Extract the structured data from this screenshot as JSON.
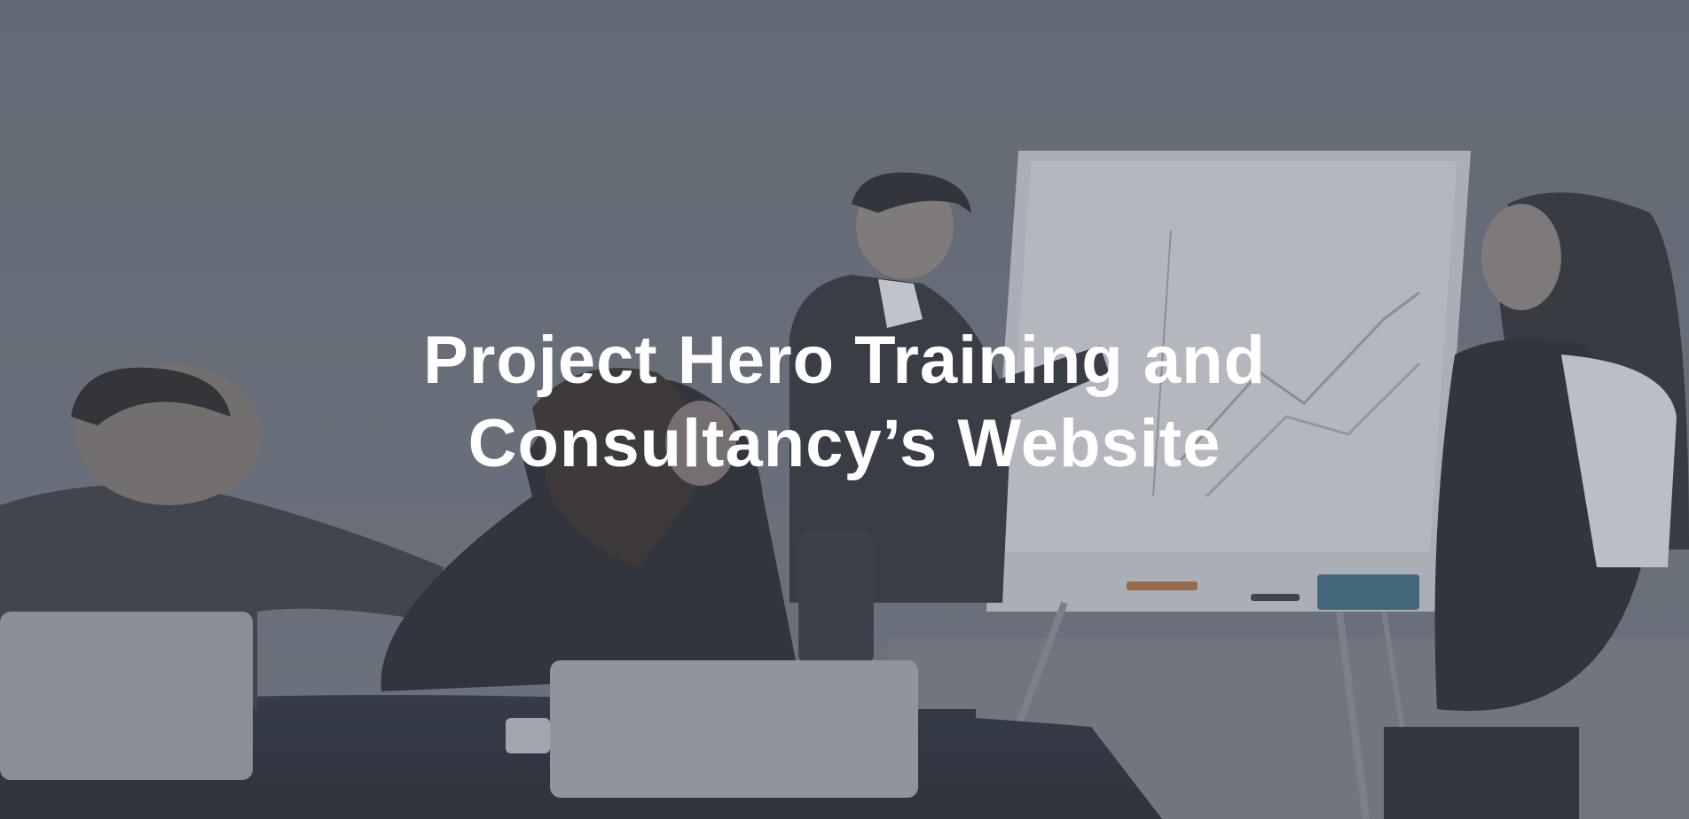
{
  "hero": {
    "title_line1": "Project Hero Training and",
    "title_line2": "Consultancy’s Website",
    "overlay_color": "#5f6470",
    "background_image": "business-meeting-photo"
  }
}
